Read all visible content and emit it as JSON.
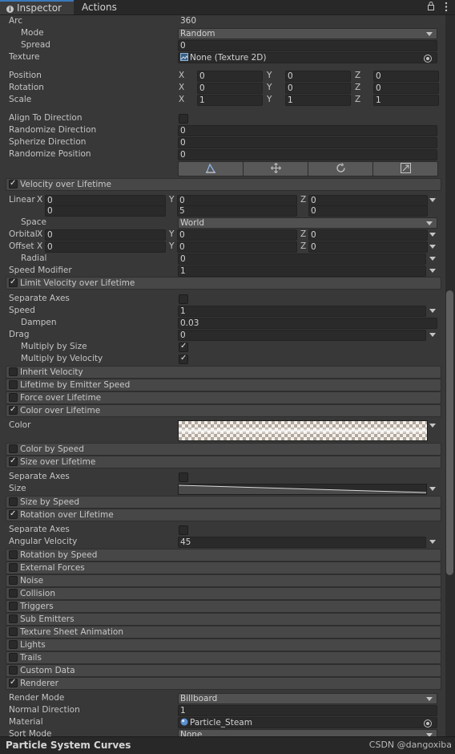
{
  "tabs": {
    "inspector": "Inspector",
    "actions": "Actions"
  },
  "arc": {
    "label": "Arc",
    "value": "360"
  },
  "mode": {
    "label": "Mode",
    "value": "Random"
  },
  "spread": {
    "label": "Spread",
    "value": "0"
  },
  "texture": {
    "label": "Texture",
    "value": "None (Texture 2D)"
  },
  "position": {
    "label": "Position",
    "x": "0",
    "y": "0",
    "z": "0"
  },
  "rotation": {
    "label": "Rotation",
    "x": "0",
    "y": "0",
    "z": "0"
  },
  "scale": {
    "label": "Scale",
    "x": "1",
    "y": "1",
    "z": "1"
  },
  "axis": {
    "x": "X",
    "y": "Y",
    "z": "Z"
  },
  "align_to_direction": {
    "label": "Align To Direction",
    "checked": false
  },
  "randomize_direction": {
    "label": "Randomize Direction",
    "value": "0"
  },
  "spherize_direction": {
    "label": "Spherize Direction",
    "value": "0"
  },
  "randomize_position": {
    "label": "Randomize Position",
    "value": "0"
  },
  "velocity": {
    "module": "Velocity over Lifetime",
    "linear_label": "Linear",
    "linear_row1": {
      "x": "0",
      "y": "0",
      "z": "0"
    },
    "linear_row2": {
      "x": "0",
      "y": "5",
      "z": "0"
    },
    "space_label": "Space",
    "space_value": "World",
    "orbital_label": "Orbital",
    "orbital": {
      "x": "0",
      "y": "0",
      "z": "0"
    },
    "offset_label": "Offset",
    "offset": {
      "x": "0",
      "y": "0",
      "z": "0"
    },
    "radial_label": "Radial",
    "radial_value": "0",
    "speed_modifier_label": "Speed Modifier",
    "speed_modifier_value": "1"
  },
  "limit_velocity": {
    "module": "Limit Velocity over Lifetime",
    "separate_axes_label": "Separate Axes",
    "speed_label": "Speed",
    "speed_value": "1",
    "dampen_label": "Dampen",
    "dampen_value": "0.03",
    "drag_label": "Drag",
    "drag_value": "0",
    "multiply_by_size_label": "Multiply by Size",
    "multiply_by_velocity_label": "Multiply by Velocity"
  },
  "modules": {
    "inherit_velocity": "Inherit Velocity",
    "lifetime_by_emitter_speed": "Lifetime by Emitter Speed",
    "force_over_lifetime": "Force over Lifetime",
    "color_over_lifetime": "Color over Lifetime",
    "color_by_speed": "Color by Speed",
    "size_over_lifetime": "Size over Lifetime",
    "size_by_speed": "Size by Speed",
    "rotation_over_lifetime": "Rotation over Lifetime",
    "rotation_by_speed": "Rotation by Speed",
    "external_forces": "External Forces",
    "noise": "Noise",
    "collision": "Collision",
    "triggers": "Triggers",
    "sub_emitters": "Sub Emitters",
    "texture_sheet_animation": "Texture Sheet Animation",
    "lights": "Lights",
    "trails": "Trails",
    "custom_data": "Custom Data",
    "renderer": "Renderer"
  },
  "color_over_lifetime": {
    "color_label": "Color"
  },
  "size_over_lifetime": {
    "separate_axes_label": "Separate Axes",
    "size_label": "Size"
  },
  "rotation_over_lifetime": {
    "separate_axes_label": "Separate Axes",
    "angular_velocity_label": "Angular Velocity",
    "angular_velocity_value": "45"
  },
  "renderer": {
    "render_mode_label": "Render Mode",
    "render_mode_value": "Billboard",
    "normal_direction_label": "Normal Direction",
    "normal_direction_value": "1",
    "material_label": "Material",
    "material_value": "Particle_Steam",
    "sort_mode_label": "Sort Mode",
    "sort_mode_value": "None"
  },
  "bottom": {
    "title": "Particle System Curves",
    "watermark": "CSDN @dangoxiba"
  },
  "colors": {
    "accent": "#3a79bb",
    "background": "#383838",
    "field": "#2a2a2a",
    "module_header": "#474747"
  }
}
